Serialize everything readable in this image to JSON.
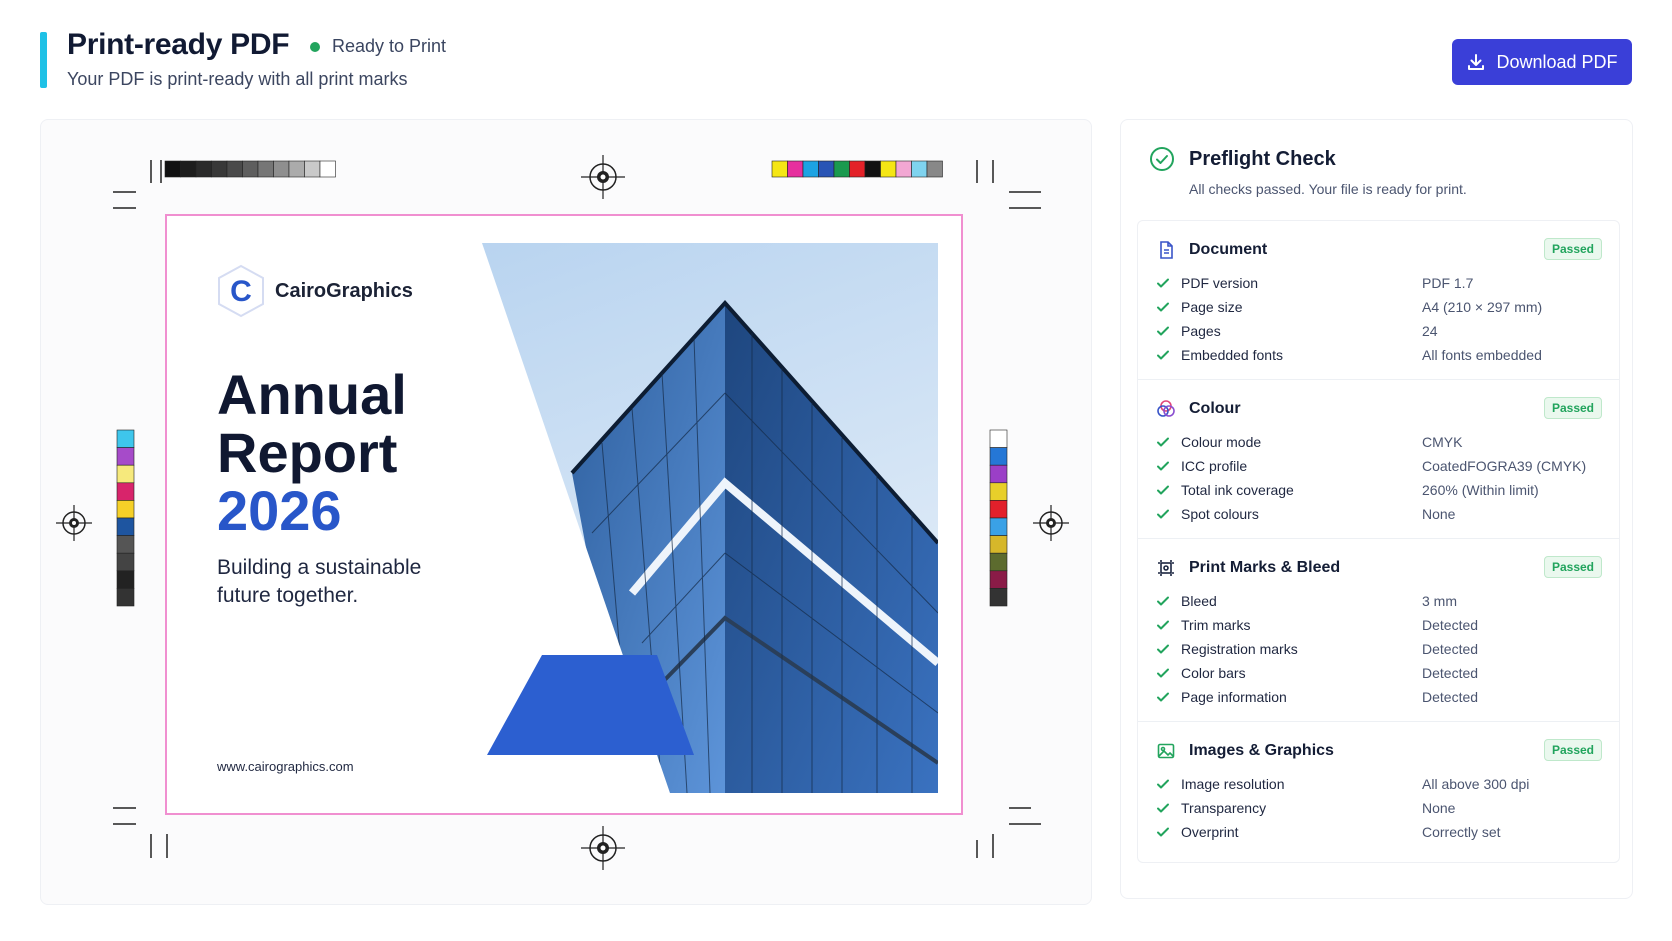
{
  "header": {
    "title": "Print-ready PDF",
    "status": "Ready to Print",
    "subtitle": "Your PDF is print-ready with all print marks",
    "download_label": "Download PDF",
    "accent_color": "#1fc1e6",
    "status_color": "#22a45d",
    "button_color": "#3a3fd8"
  },
  "preview": {
    "logo_letter": "C",
    "logo_name": "CairoGraphics",
    "title_line1": "Annual",
    "title_line2": "Report",
    "title_year": "2026",
    "tagline": "Building a sustainable future together.",
    "website": "www.cairographics.com",
    "bleed_color": "#f08fd0",
    "brand_color": "#2856c9",
    "grayscale_bar": [
      "#111111",
      "#1d1d1d",
      "#2a2a2a",
      "#383838",
      "#4a4a4a",
      "#5e5e5e",
      "#767676",
      "#8f8f8f",
      "#ababab",
      "#c9c9c9",
      "#ffffff"
    ],
    "color_bar": [
      "#f5e614",
      "#e62f9e",
      "#1ca3e3",
      "#2954b5",
      "#1a9a4f",
      "#e32128",
      "#111111",
      "#f5e614",
      "#f2a7d3",
      "#7fd3ef",
      "#888888"
    ],
    "left_strip": [
      "#3ec6ec",
      "#a64bc9",
      "#f6e97c",
      "#d8246b",
      "#f5d028",
      "#1e55a0",
      "#555555",
      "#444444",
      "#222222",
      "#333333"
    ],
    "right_strip": [
      "#ffffff",
      "#2577d6",
      "#9b3fc7",
      "#e8cf2a",
      "#e2202b",
      "#3aa1e6",
      "#d6b72a",
      "#5c6b2e",
      "#8a1b47",
      "#333333"
    ]
  },
  "preflight": {
    "title": "Preflight Check",
    "subtitle": "All checks passed. Your file is ready for print.",
    "sections": [
      {
        "title": "Document",
        "icon": "document-icon",
        "status": "Passed",
        "rows": [
          {
            "label": "PDF version",
            "value": "PDF 1.7"
          },
          {
            "label": "Page size",
            "value": "A4 (210 × 297 mm)"
          },
          {
            "label": "Pages",
            "value": "24"
          },
          {
            "label": "Embedded fonts",
            "value": "All fonts embedded"
          }
        ]
      },
      {
        "title": "Colour",
        "icon": "colour-icon",
        "status": "Passed",
        "rows": [
          {
            "label": "Colour mode",
            "value": "CMYK"
          },
          {
            "label": "ICC profile",
            "value": "CoatedFOGRA39 (CMYK)"
          },
          {
            "label": "Total ink coverage",
            "value": "260% (Within limit)"
          },
          {
            "label": "Spot colours",
            "value": "None"
          }
        ]
      },
      {
        "title": "Print Marks & Bleed",
        "icon": "print-marks-icon",
        "status": "Passed",
        "rows": [
          {
            "label": "Bleed",
            "value": "3 mm"
          },
          {
            "label": "Trim marks",
            "value": "Detected"
          },
          {
            "label": "Registration marks",
            "value": "Detected"
          },
          {
            "label": "Color bars",
            "value": "Detected"
          },
          {
            "label": "Page information",
            "value": "Detected"
          }
        ]
      },
      {
        "title": "Images & Graphics",
        "icon": "image-icon",
        "status": "Passed",
        "rows": [
          {
            "label": "Image resolution",
            "value": "All above 300 dpi"
          },
          {
            "label": "Transparency",
            "value": "None"
          },
          {
            "label": "Overprint",
            "value": "Correctly set"
          }
        ]
      }
    ]
  }
}
